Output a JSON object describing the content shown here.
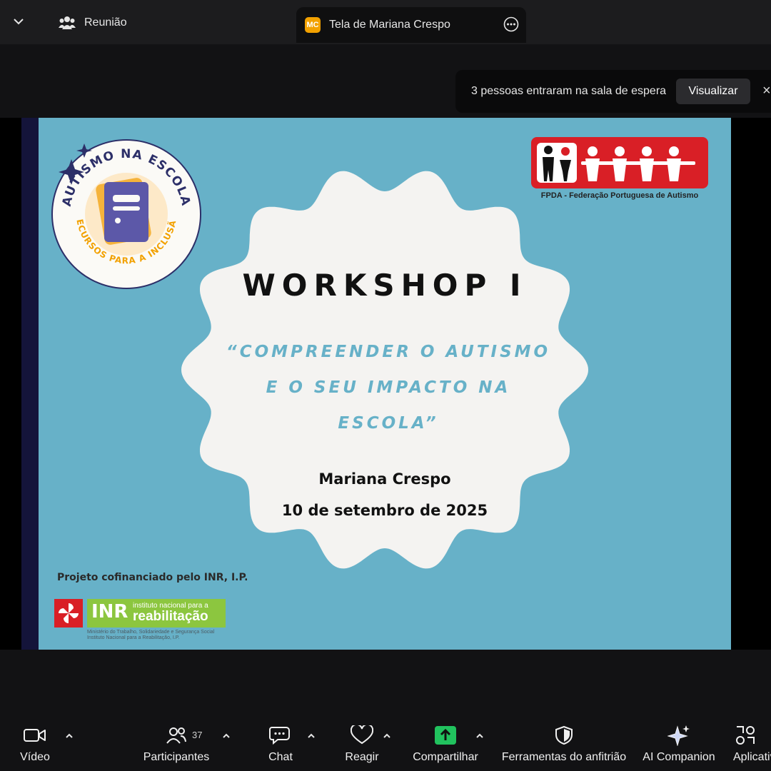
{
  "tabs": {
    "meeting_label": "Reunião",
    "share_badge": "MC",
    "share_label": "Tela de Mariana Crespo"
  },
  "notification": {
    "text": "3 pessoas entraram na sala de espera",
    "button": "Visualizar",
    "close": "×"
  },
  "slide": {
    "title": "WORKSHOP I",
    "subtitle_lines": [
      "“COMPREENDER O AUTISMO",
      "E O SEU IMPACTO NA",
      "ESCOLA”"
    ],
    "presenter": "Mariana Crespo",
    "date": "10 de setembro de 2025",
    "cofinance": "Projeto cofinanciado pelo INR, I.P.",
    "badge_top": "AUTISMO NA ESCOLA",
    "badge_bottom": "RECURSOS PARA A INCLUSÃO",
    "fpda_caption": "FPDA - Federação Portuguesa de Autismo",
    "inr_mark": "INR",
    "inr_line1": "instituto nacional para a",
    "inr_line2": "reabilitação",
    "inr_ministry1": "Ministério do Trabalho, Solidariedade e Segurança Social",
    "inr_ministry2": "Instituto Nacional para a Reabilitação, I.P."
  },
  "toolbar": {
    "video": "Vídeo",
    "participants": "Participantes",
    "participants_count": "37",
    "chat": "Chat",
    "react": "Reagir",
    "share": "Compartilhar",
    "host_tools": "Ferramentas do anfitrião",
    "ai": "AI Companion",
    "apps": "Aplicativos"
  },
  "colors": {
    "slide_bg": "#67b1c8",
    "share_green": "#21c25e",
    "fpda_red": "#d91f26",
    "inr_green": "#8cc63f"
  },
  "icons": [
    "chevron-down-icon",
    "people-icon",
    "more-icon",
    "close-icon",
    "video-icon",
    "participants-icon",
    "chat-icon",
    "heart-icon",
    "share-up-icon",
    "shield-icon",
    "sparkle-icon",
    "apps-icon",
    "caret-up-icon"
  ]
}
